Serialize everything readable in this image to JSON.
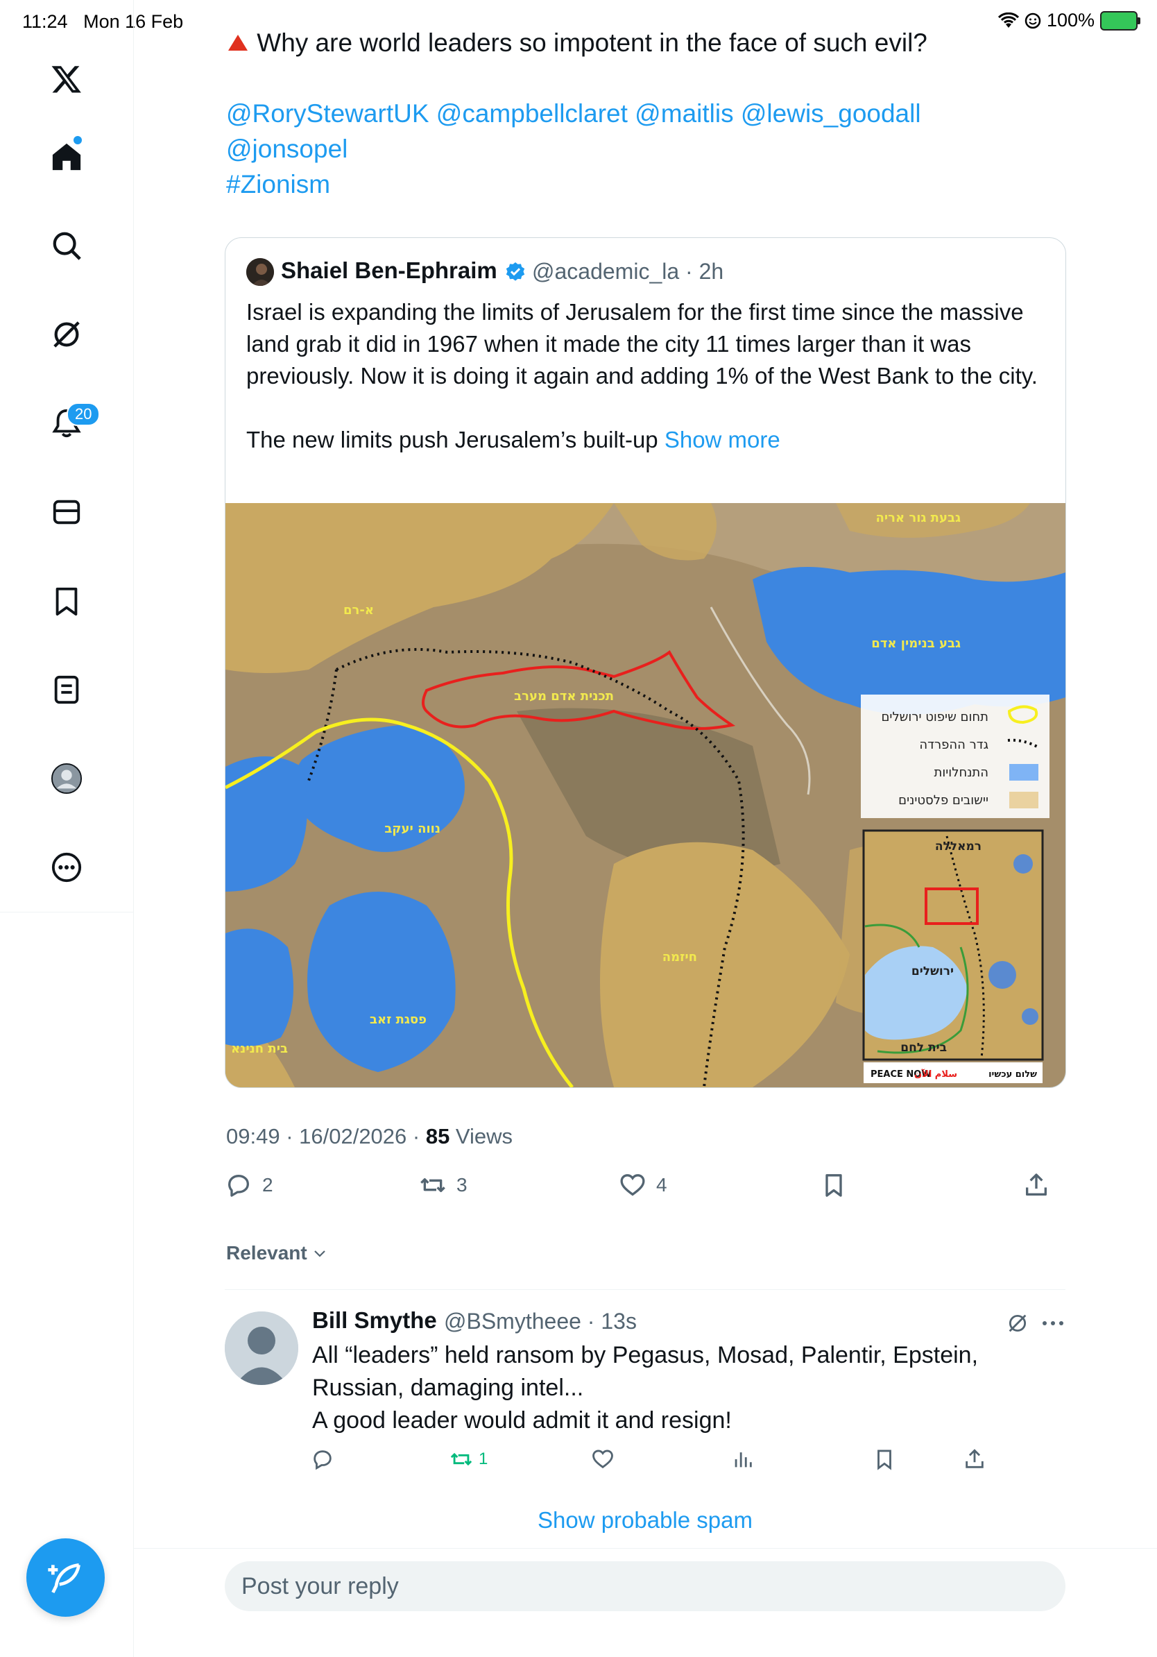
{
  "status_bar": {
    "time": "11:24",
    "date": "Mon 16 Feb",
    "battery": "100%"
  },
  "sidebar": {
    "logo": "x-logo-icon",
    "notifications_badge": "20",
    "items": [
      "home-icon",
      "search-icon",
      "grok-icon",
      "notifications-icon",
      "messages-icon",
      "bookmarks-icon",
      "lists-icon",
      "profile-icon",
      "more-icon"
    ]
  },
  "tweet": {
    "text_line1": "Why are world leaders so impotent in the face of such evil?",
    "mentions_line1": "@RoryStewartUK @campbellclaret @maitlis @lewis_goodall",
    "mentions_line2": "@jonsopel",
    "hashtag": "#Zionism",
    "timestamp": "09:49 · 16/02/2026 · ",
    "views_count": "85",
    "views_label": " Views",
    "replies": "2",
    "reposts": "3",
    "likes": "4"
  },
  "quote": {
    "name": "Shaiel Ben-Ephraim",
    "handle": "@academic_la · 2h",
    "text": "Israel is expanding the limits of Jerusalem for the first time since the massive land grab it did in 1967 when it made the city 11 times larger than it was previously. Now it is doing it again and adding 1% of the West Bank to the city.",
    "text2": "The new limits push Jerusalem’s built-up ",
    "show_more": "Show more",
    "map": {
      "label_top": "גבעת גור אריה",
      "label_aram": "א-רם",
      "label_gevabinyamin": "גבע בנימין אדם",
      "label_plan": "תכנית אדם מערב",
      "label_neveyaakov": "נווה יעקב",
      "label_hizma": "חיזמה",
      "label_pisgatzeev": "פסגת זאב",
      "label_beithanina": "בית חנינא",
      "legend": [
        "תחום שיפוט ירושלים",
        "גדר ההפרדה",
        "התנחלויות",
        "יישובים פלסטינים"
      ],
      "inset_ramallah": "רמאללה",
      "inset_jerusalem": "ירושלים",
      "inset_bethlehem": "בית לחם",
      "logo": "PEACE NOW",
      "logo_he": "שלום עכשיו",
      "logo_ar": "سلام الآن"
    }
  },
  "sort_label": "Relevant",
  "reply": {
    "name": "Bill Smythe",
    "handle": "@BSmytheee · 13s",
    "text_line1": "All “leaders” held ransom by Pegasus, Mosad, Palentir, Epstein,",
    "text_line2": "Russian,  damaging intel...",
    "text_line3": "A good leader would admit it and resign!",
    "reposts": "1"
  },
  "show_spam": "Show probable spam",
  "reply_placeholder": "Post your reply",
  "colors": {
    "accent": "#1d9bf0",
    "repost_green": "#00ba7c",
    "map_settlement": "#3d86e0",
    "map_palestinian": "#c9a862",
    "jerusalem_boundary": "#f7ef1f",
    "plan_outline": "#e8201d"
  }
}
